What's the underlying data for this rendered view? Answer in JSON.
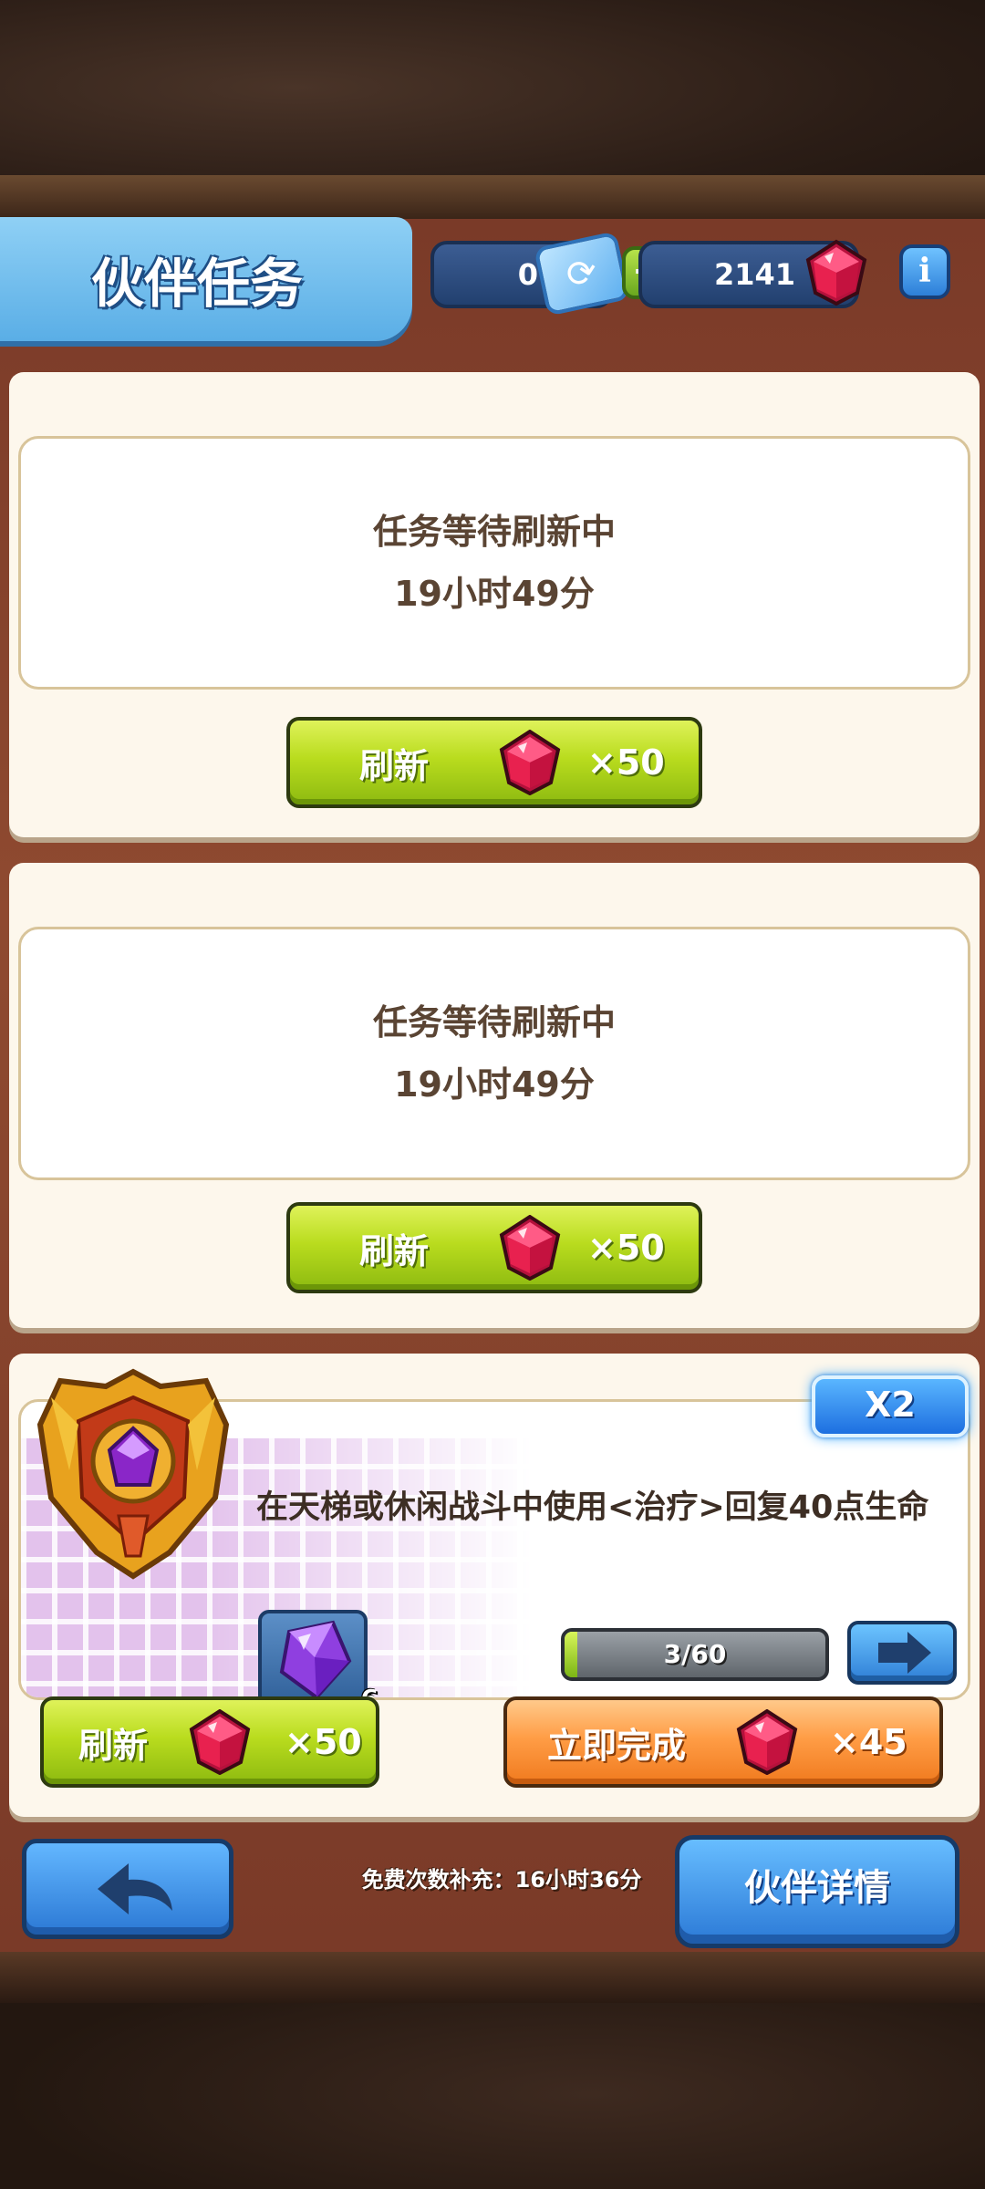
{
  "header": {
    "title": "伙伴任务",
    "tickets": "0",
    "gems": "2141"
  },
  "slots": [
    {
      "status": "任务等待刷新中",
      "timer": "19小时49分",
      "refresh_label": "刷新",
      "refresh_cost": "×50"
    },
    {
      "status": "任务等待刷新中",
      "timer": "19小时49分",
      "refresh_label": "刷新",
      "refresh_cost": "×50"
    }
  ],
  "task": {
    "multiplier": "X2",
    "description": "在天梯或休闲战斗中使用<治疗>回复40点生命",
    "reward_count": "6",
    "progress_text": "3/60",
    "progress": 0.05,
    "refresh_label": "刷新",
    "refresh_cost": "×50",
    "complete_label": "立即完成",
    "complete_cost": "×45"
  },
  "footer": {
    "free_refill": "免费次数补充：16小时36分",
    "partner_details": "伙伴详情"
  },
  "colors": {
    "green_button": "#b9dc1e",
    "orange_button": "#ff9d46",
    "blue_button": "#2b78d4",
    "panel": "#fdf7ec",
    "gem": "#e8214f"
  },
  "icons": {
    "ticket": "ticket-icon",
    "gem": "gem-icon",
    "info": "info-icon",
    "back": "back-arrow-icon",
    "next": "right-arrow-icon"
  }
}
